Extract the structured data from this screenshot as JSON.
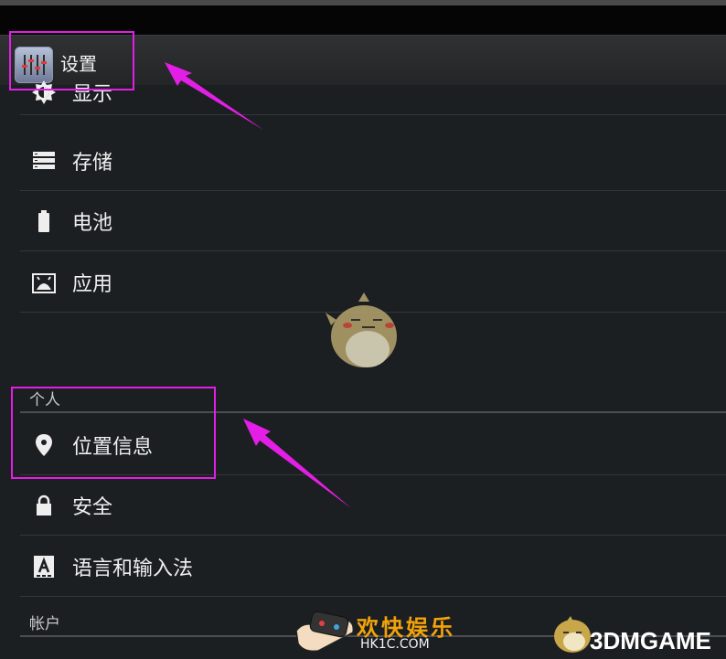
{
  "app": {
    "title": "设置",
    "icon": "equalizer-icon"
  },
  "list": {
    "items": [
      {
        "label": "显示",
        "icon": "brightness-icon"
      },
      {
        "label": "存储",
        "icon": "storage-icon"
      },
      {
        "label": "电池",
        "icon": "battery-icon"
      },
      {
        "label": "应用",
        "icon": "apps-icon"
      }
    ]
  },
  "sections": {
    "personal": {
      "title": "个人",
      "items": [
        {
          "label": "位置信息",
          "icon": "location-pin-icon"
        },
        {
          "label": "安全",
          "icon": "lock-icon"
        },
        {
          "label": "语言和输入法",
          "icon": "keyboard-a-icon"
        }
      ]
    },
    "accounts": {
      "title": "帐户"
    }
  },
  "annotations": {
    "highlight_color": "#e31ee6"
  },
  "watermarks": {
    "left_cn": "欢快娱乐",
    "left_url": "HK1C.COM",
    "right_brand_num": "3",
    "right_brand_txt": "DMGAME"
  },
  "colors": {
    "background": "#1c1f22",
    "actionbar": "#2b2d2f",
    "divider": "#34373a"
  }
}
